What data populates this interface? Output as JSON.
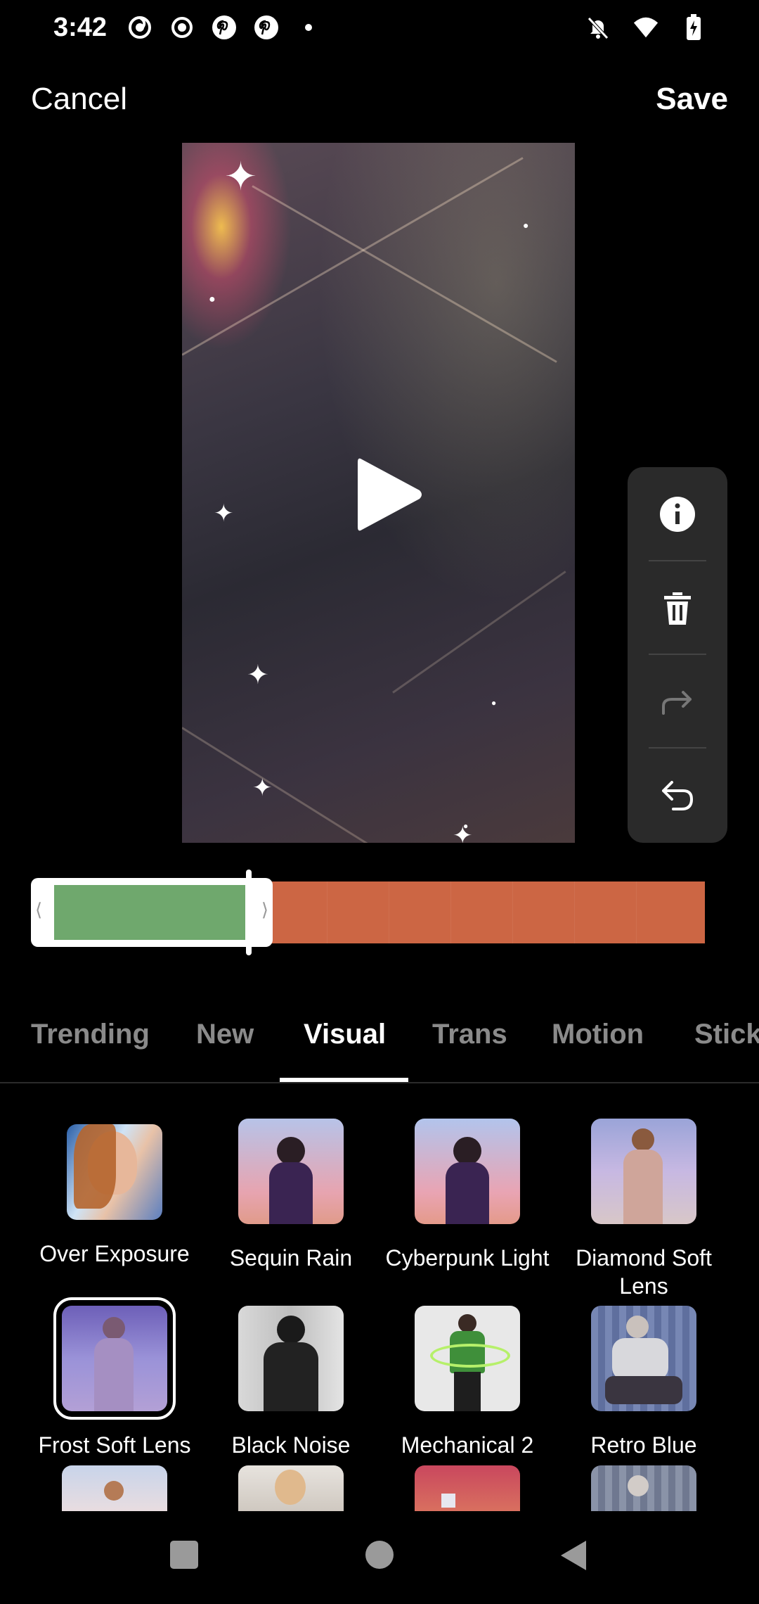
{
  "status": {
    "time": "3:42"
  },
  "nav": {
    "cancel_label": "Cancel",
    "save_label": "Save"
  },
  "preview": {
    "play_icon": "play-icon"
  },
  "tools": [
    {
      "name": "info-icon"
    },
    {
      "name": "trash-icon"
    },
    {
      "name": "redo-icon"
    },
    {
      "name": "undo-icon"
    }
  ],
  "tabs": [
    {
      "label": "Trending",
      "active": false
    },
    {
      "label": "New",
      "active": false
    },
    {
      "label": "Visual",
      "active": true
    },
    {
      "label": "Trans",
      "active": false
    },
    {
      "label": "Motion",
      "active": false
    },
    {
      "label": "Stick",
      "active": false
    }
  ],
  "effects": [
    {
      "label": "Over Exposure",
      "selected": false
    },
    {
      "label": "Sequin Rain",
      "selected": false
    },
    {
      "label": "Cyberpunk Light",
      "selected": false
    },
    {
      "label": "Diamond Soft Lens",
      "selected": false
    },
    {
      "label": "Frost Soft Lens",
      "selected": true
    },
    {
      "label": "Black Noise",
      "selected": false
    },
    {
      "label": "Mechanical 2",
      "selected": false
    },
    {
      "label": "Retro Blue",
      "selected": false
    }
  ],
  "colors": {
    "timeline_applied": "#6fa86d",
    "timeline_track": "#cc6644",
    "panel_bg": "#2a2a2a"
  }
}
